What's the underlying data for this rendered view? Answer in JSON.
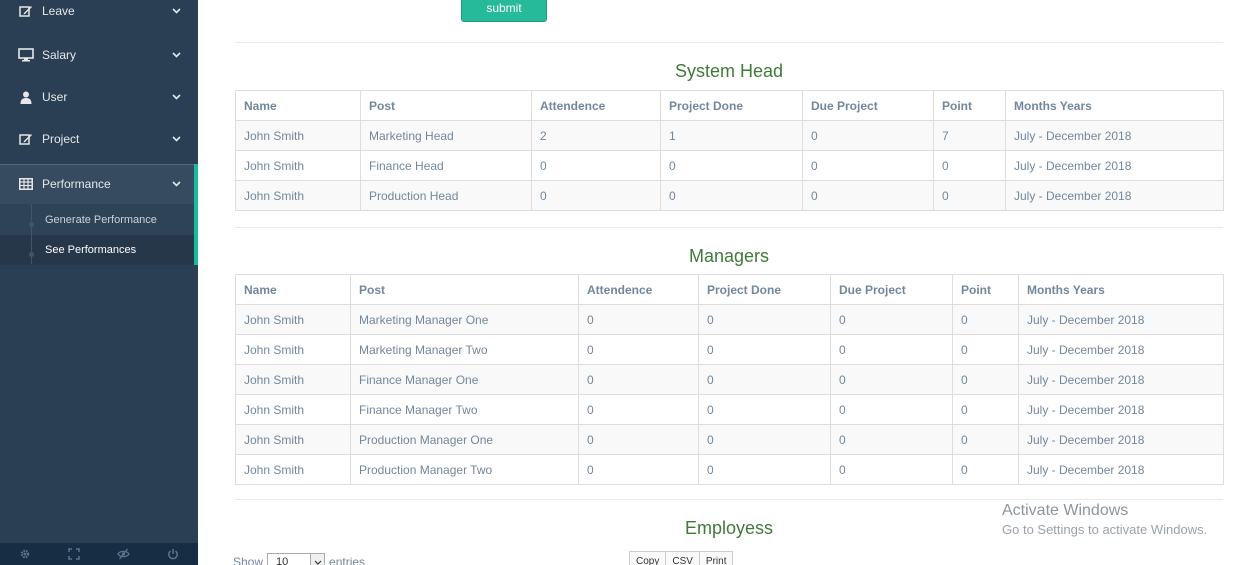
{
  "sidebar": {
    "items": [
      {
        "label": "Leave",
        "icon": "edit-icon"
      },
      {
        "label": "Salary",
        "icon": "desktop-icon"
      },
      {
        "label": "User",
        "icon": "user-icon"
      },
      {
        "label": "Project",
        "icon": "edit-icon"
      },
      {
        "label": "Performance",
        "icon": "table-icon"
      }
    ],
    "submenu": [
      "Generate Performance",
      "See Performances"
    ],
    "footer_icons": [
      "gear-icon",
      "fullscreen-icon",
      "eye-slash-icon",
      "power-icon"
    ]
  },
  "main": {
    "submit_label": "submit",
    "system_head": {
      "title": "System Head",
      "headers": [
        "Name",
        "Post",
        "Attendence",
        "Project Done",
        "Due Project",
        "Point",
        "Months Years"
      ],
      "rows": [
        [
          "John Smith",
          "Marketing Head",
          "2",
          "1",
          "0",
          "7",
          "July - December 2018"
        ],
        [
          "John Smith",
          "Finance Head",
          "0",
          "0",
          "0",
          "0",
          "July - December 2018"
        ],
        [
          "John Smith",
          "Production Head",
          "0",
          "0",
          "0",
          "0",
          "July - December 2018"
        ]
      ]
    },
    "managers": {
      "title": "Managers",
      "headers": [
        "Name",
        "Post",
        "Attendence",
        "Project Done",
        "Due Project",
        "Point",
        "Months Years"
      ],
      "rows": [
        [
          "John Smith",
          "Marketing Manager One",
          "0",
          "0",
          "0",
          "0",
          "July - December 2018"
        ],
        [
          "John Smith",
          "Marketing Manager Two",
          "0",
          "0",
          "0",
          "0",
          "July - December 2018"
        ],
        [
          "John Smith",
          "Finance Manager One",
          "0",
          "0",
          "0",
          "0",
          "July - December 2018"
        ],
        [
          "John Smith",
          "Finance Manager Two",
          "0",
          "0",
          "0",
          "0",
          "July - December 2018"
        ],
        [
          "John Smith",
          "Production Manager One",
          "0",
          "0",
          "0",
          "0",
          "July - December 2018"
        ],
        [
          "John Smith",
          "Production Manager Two",
          "0",
          "0",
          "0",
          "0",
          "July - December 2018"
        ]
      ]
    },
    "employees": {
      "title": "Employess",
      "show_label": "Show",
      "entries_value": "10",
      "entries_label": "entries",
      "export_buttons": [
        "Copy",
        "CSV",
        "Print"
      ]
    }
  },
  "watermark": {
    "line1": "Activate Windows",
    "line2": "Go to Settings to activate Windows."
  },
  "colors": {
    "sidebar_bg": "#2A3F54",
    "accent": "#1ABB9C",
    "title_green": "#3F7A3A",
    "button_green": "#26B99A"
  }
}
